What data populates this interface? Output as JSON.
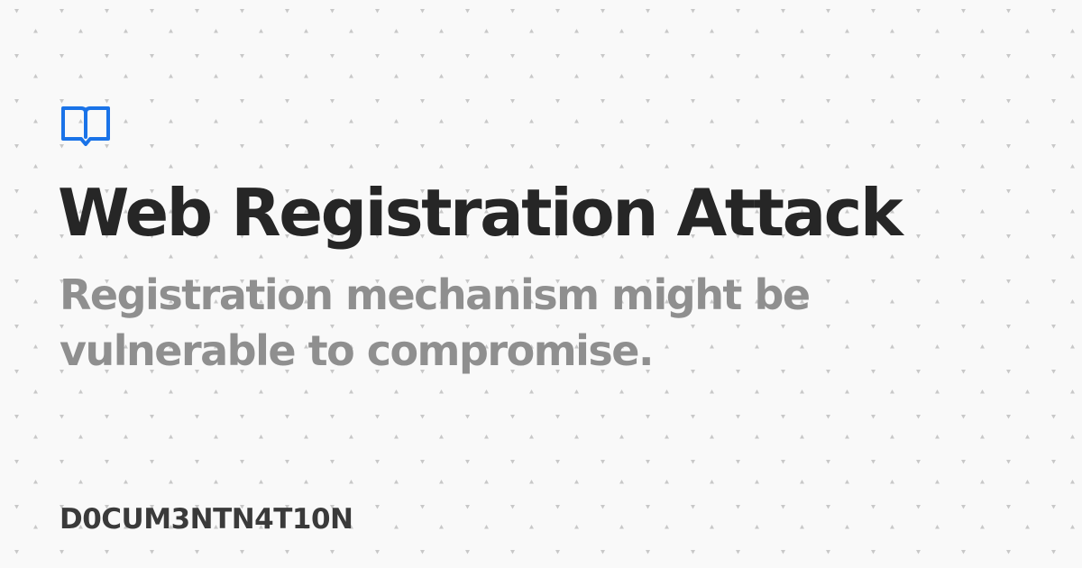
{
  "header": {
    "logo_icon": "book-icon",
    "logo_color": "#1a73e8"
  },
  "main": {
    "title": "Web Registration Attack",
    "subtitle": "Registration mechanism might be vulnerable to compromise."
  },
  "footer": {
    "brand": "D0CUM3NTN4T10N"
  },
  "colors": {
    "background": "#f9f9f9",
    "pattern_dot": "#c8c8c8",
    "title": "#262626",
    "subtitle": "#8f8f8f",
    "brand": "#3a3a3a"
  }
}
